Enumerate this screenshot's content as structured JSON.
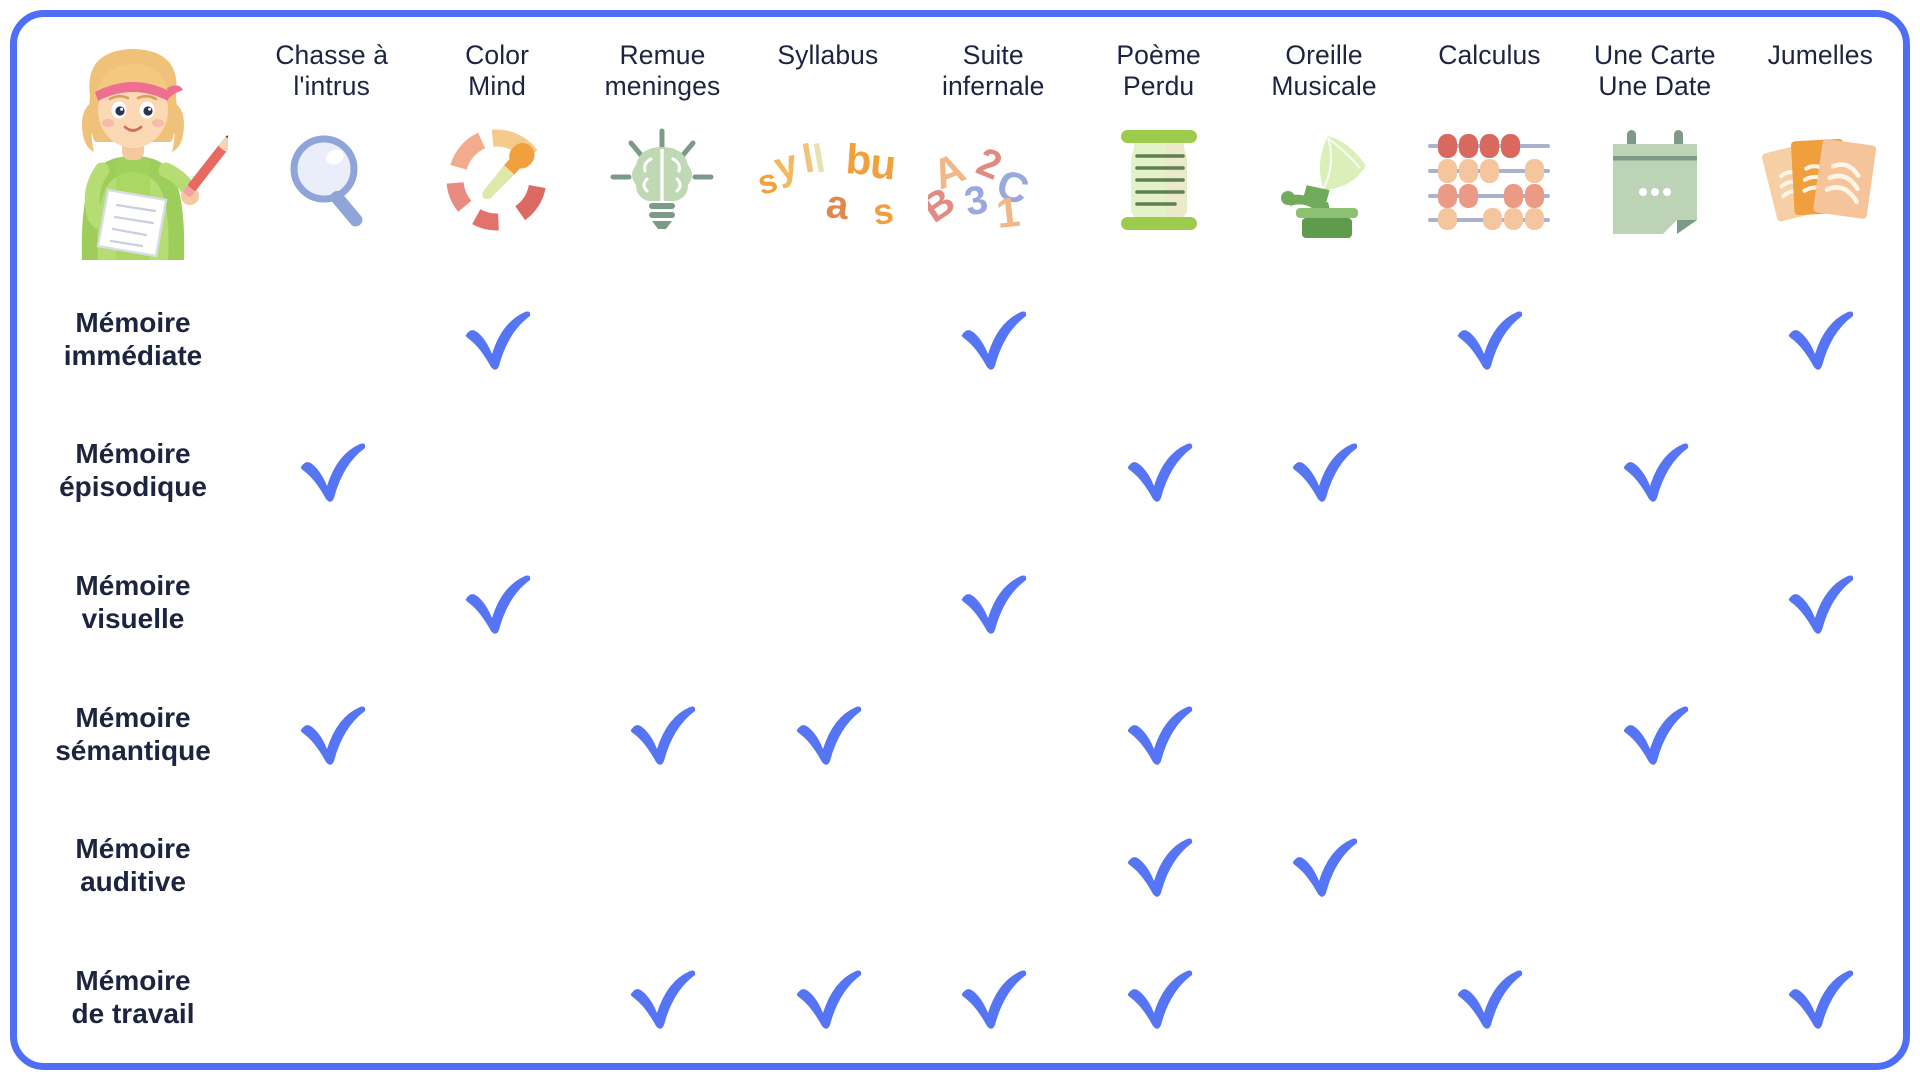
{
  "theme": {
    "border_color": "#4d6ef5",
    "grid_line_color": "#8e9df0",
    "check_color": "#5575f5",
    "text_color": "#1d2440",
    "background": "#ffffff"
  },
  "corner": {
    "icon": "girl-writing-mascot-illustration"
  },
  "columns": [
    {
      "label_lines": [
        "Chasse à",
        "l'intrus"
      ],
      "icon": "magnifying-glass-icon"
    },
    {
      "label_lines": [
        "Color",
        "Mind"
      ],
      "icon": "color-wheel-eyedropper-icon"
    },
    {
      "label_lines": [
        "Remue",
        "meninges"
      ],
      "icon": "brain-lightbulb-icon"
    },
    {
      "label_lines": [
        "Syllabus"
      ],
      "icon": "scattered-syllables-icon"
    },
    {
      "label_lines": [
        "Suite",
        "infernale"
      ],
      "icon": "scattered-letters-numbers-icon"
    },
    {
      "label_lines": [
        "Poème",
        "Perdu"
      ],
      "icon": "scroll-icon"
    },
    {
      "label_lines": [
        "Oreille",
        "Musicale"
      ],
      "icon": "gramophone-icon"
    },
    {
      "label_lines": [
        "Calculus"
      ],
      "icon": "abacus-icon"
    },
    {
      "label_lines": [
        "Une Carte",
        "Une Date"
      ],
      "icon": "calendar-icon"
    },
    {
      "label_lines": [
        "Jumelles"
      ],
      "icon": "photo-cards-icon"
    }
  ],
  "rows": [
    {
      "label_lines": [
        "Mémoire",
        "immédiate"
      ],
      "checks": [
        0,
        1,
        0,
        0,
        1,
        0,
        0,
        1,
        0,
        1
      ]
    },
    {
      "label_lines": [
        "Mémoire",
        "épisodique"
      ],
      "checks": [
        1,
        0,
        0,
        0,
        0,
        1,
        1,
        0,
        1,
        0
      ]
    },
    {
      "label_lines": [
        "Mémoire",
        "visuelle"
      ],
      "checks": [
        0,
        1,
        0,
        0,
        1,
        0,
        0,
        0,
        0,
        1
      ]
    },
    {
      "label_lines": [
        "Mémoire",
        "sémantique"
      ],
      "checks": [
        1,
        0,
        1,
        1,
        0,
        1,
        0,
        0,
        1,
        0
      ]
    },
    {
      "label_lines": [
        "Mémoire",
        "auditive"
      ],
      "checks": [
        0,
        0,
        0,
        0,
        0,
        1,
        1,
        0,
        0,
        0
      ]
    },
    {
      "label_lines": [
        "Mémoire",
        "de travail"
      ],
      "checks": [
        0,
        0,
        1,
        1,
        1,
        1,
        0,
        1,
        0,
        1
      ]
    }
  ],
  "check_glyph": "checkmark"
}
